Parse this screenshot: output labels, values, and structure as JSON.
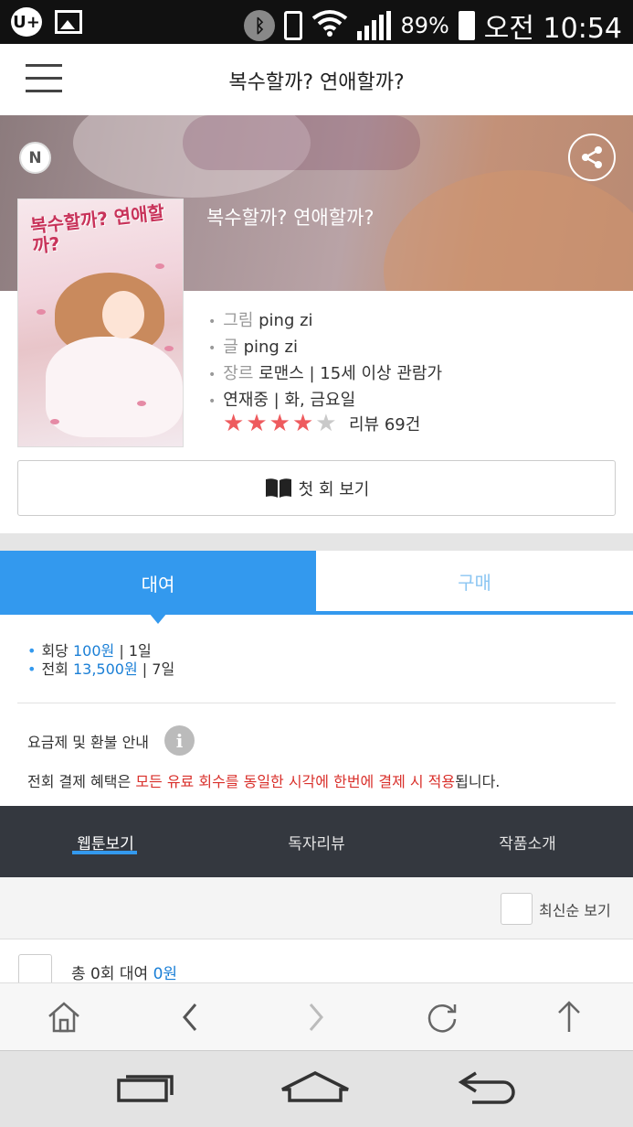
{
  "status_bar": {
    "left_badge": "U+",
    "battery_percent": "89%",
    "time": "오전 10:54",
    "icons": [
      "uplus-icon",
      "image-icon",
      "bluetooth-icon",
      "vibrate-icon",
      "wifi-icon",
      "signal-icon",
      "battery-icon"
    ]
  },
  "header": {
    "title": "복수할까? 연애할까?"
  },
  "work": {
    "badge": "N",
    "title": "복수할까? 연애할까?",
    "cover_title": "복수할까? 연애할까?",
    "art_label": "그림",
    "art_value": "ping zi",
    "story_label": "글",
    "story_value": "ping zi",
    "genre_label": "장르",
    "genre_value": "로맨스 | 15세 이상 관람가",
    "schedule": "연재중 | 화, 금요일",
    "rating_stars": 4,
    "rating_max": 5,
    "review": "리뷰 69건",
    "first_episode_button": "첫 회 보기"
  },
  "purchase_tabs": {
    "rent": "대여",
    "buy": "구매",
    "active": "rent"
  },
  "pricing": {
    "per_episode_label": "회당",
    "per_episode_price": "100원",
    "per_episode_period": "| 1일",
    "all_label": "전회",
    "all_price": "13,500원",
    "all_period": "| 7일",
    "refund_info": "요금제 및 환불 안내",
    "benefit_prefix": "전회 결제 혜택은 ",
    "benefit_highlight": "모든 유료 회수를 동일한 시각에 한번에 결제 시 적용",
    "benefit_suffix": "됩니다."
  },
  "content_tabs": {
    "items": [
      "웹툰보기",
      "독자리뷰",
      "작품소개"
    ],
    "active": 0
  },
  "list": {
    "latest_label": "최신순 보기",
    "total_prefix": "총 0회 대여 ",
    "total_amount": "0원"
  },
  "colors": {
    "accent": "#3399ee",
    "highlight_red": "#d9302b",
    "dark_tabs": "#34383f",
    "star_filled": "#ee5b5e",
    "star_empty": "#c9c9c9"
  }
}
